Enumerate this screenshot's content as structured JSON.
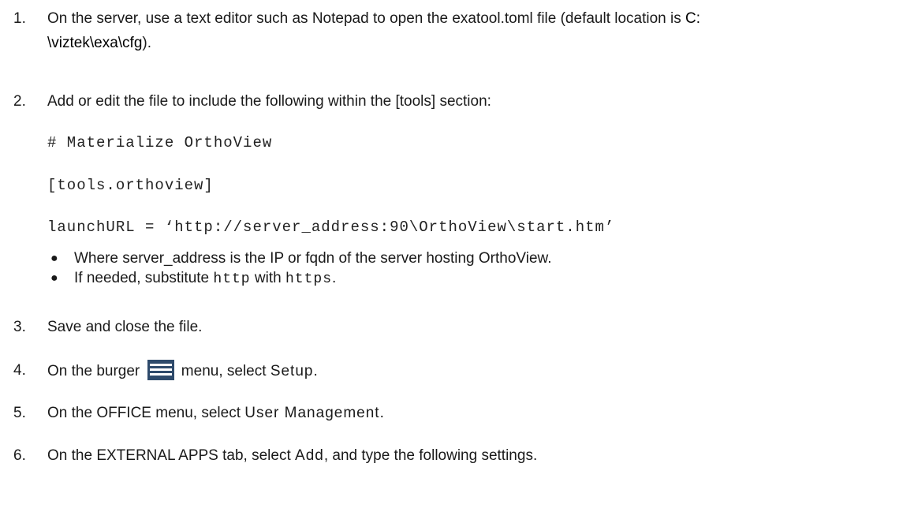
{
  "steps": [
    {
      "num": "1.",
      "line1_a": "On the server, use a text editor such as Notepad to open the exatool.toml file (default location is ",
      "line1_b": "C:",
      "line2_a": "\\viztek\\exa\\cfg",
      "line2_b": ")."
    },
    {
      "num": "2.",
      "text": "Add or edit the file to include the following within the [tools] section:",
      "code": [
        "# Materialize OrthoView",
        "[tools.orthoview]",
        "launchURL = ‘http://server_address:90\\OrthoView\\start.htm’"
      ],
      "bullets": [
        {
          "text": "Where server_address is the IP or fqdn of the server hosting OrthoView."
        },
        {
          "pre": "If needed, substitute ",
          "code1": "http",
          "mid": " with ",
          "code2": "https",
          "post": "."
        }
      ]
    },
    {
      "num": "3.",
      "text": "Save and close the file."
    },
    {
      "num": "4.",
      "pre": "On the burger ",
      "icon": "burger-menu-icon",
      "post": " menu, select ",
      "term": "Setup",
      "end": "."
    },
    {
      "num": "5.",
      "pre": "On the OFFICE menu, select ",
      "term": "User Management",
      "end": "."
    },
    {
      "num": "6.",
      "pre": "On the EXTERNAL APPS tab, select ",
      "term": "Add",
      "post": ", and type the following settings."
    }
  ],
  "colors": {
    "text": "#1a1a1a",
    "icon_bg": "#2e4a6b"
  }
}
